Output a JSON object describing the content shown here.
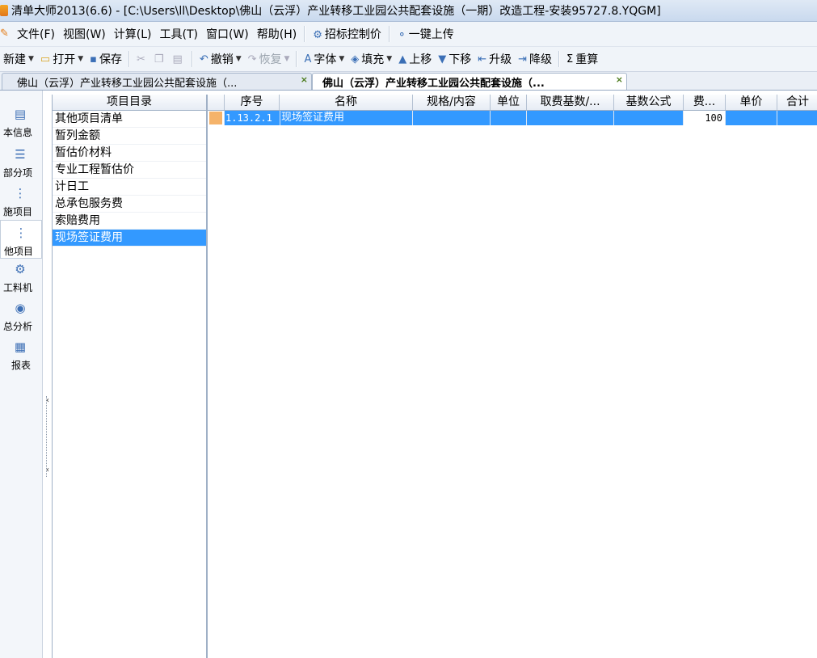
{
  "window": {
    "title": "清单大师2013(6.6) - [C:\\Users\\ll\\Desktop\\佛山（云浮）产业转移工业园公共配套设施（一期）改造工程-安装95727.8.YQGM]"
  },
  "menu": {
    "items": [
      "文件(F)",
      "视图(W)",
      "计算(L)",
      "工具(T)",
      "窗口(W)",
      "帮助(H)"
    ],
    "bid_control": "招标控制价",
    "upload": "一键上传"
  },
  "toolbar": {
    "new": "新建",
    "open": "打开",
    "save": "保存",
    "undo": "撤销",
    "redo": "恢复",
    "font": "字体",
    "fill": "填充",
    "move_up": "上移",
    "move_down": "下移",
    "upgrade": "升级",
    "downgrade": "降级",
    "recalc_symbol": "Σ",
    "recalc": "重算"
  },
  "tabs": [
    {
      "label": "佛山（云浮）产业转移工业园公共配套设施（...",
      "close": "×",
      "active": false
    },
    {
      "label": "佛山（云浮）产业转移工业园公共配套设施（...",
      "close": "×",
      "active": true
    }
  ],
  "sidebar": {
    "items": [
      {
        "label": "本信息",
        "icon": "document-icon"
      },
      {
        "label": "部分项",
        "icon": "list-icon"
      },
      {
        "label": "施项目",
        "icon": "tree-icon"
      },
      {
        "label": "他项目",
        "icon": "tree-icon",
        "active": true
      },
      {
        "label": "工料机",
        "icon": "gears-icon"
      },
      {
        "label": "总分析",
        "icon": "chart-icon"
      },
      {
        "label": "报表",
        "icon": "report-icon"
      }
    ]
  },
  "directory": {
    "header": "项目目录",
    "items": [
      "其他项目清单",
      "暂列金额",
      "暂估价材料",
      "专业工程暂估价",
      "计日工",
      "总承包服务费",
      "索赔费用",
      "现场签证费用"
    ],
    "selected_index": 7
  },
  "grid": {
    "columns": [
      "序号",
      "名称",
      "规格/内容",
      "单位",
      "取费基数/...",
      "基数公式",
      "费...",
      "单价",
      "合计"
    ],
    "rows": [
      {
        "seq": "1.13.2.1",
        "name": "现场签证费用",
        "spec": "",
        "unit": "",
        "base": "",
        "formula": "",
        "rate": "100",
        "price": "",
        "total": ""
      }
    ]
  },
  "splitter": {
    "arrow_top": "‹",
    "arrow_bottom": "‹"
  },
  "colors": {
    "selection": "#3399ff",
    "row_marker": "#f5b36a"
  }
}
